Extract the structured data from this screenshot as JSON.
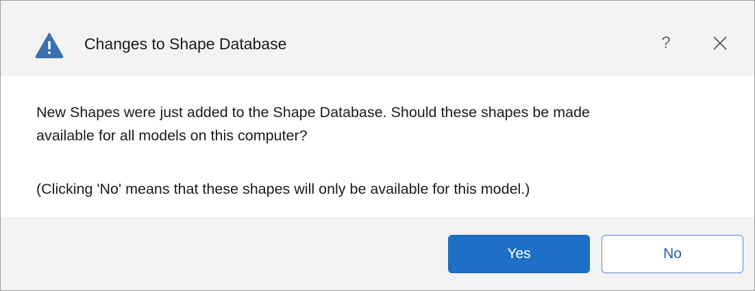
{
  "dialog": {
    "title": "Changes to Shape Database",
    "help_glyph": "?",
    "icons": {
      "title": "warning-icon",
      "close": "close-icon"
    },
    "message": {
      "line1": "New Shapes were just added to the Shape Database. Should these shapes be made",
      "line2": "available for all models on this computer?",
      "note": "(Clicking 'No' means that these shapes will only be available for this model.)"
    },
    "buttons": {
      "yes": "Yes",
      "no": "No"
    },
    "colors": {
      "warning": "#3d6fb0",
      "primary_button": "#1f6fc6",
      "secondary_button_border": "#4a88d0"
    }
  }
}
